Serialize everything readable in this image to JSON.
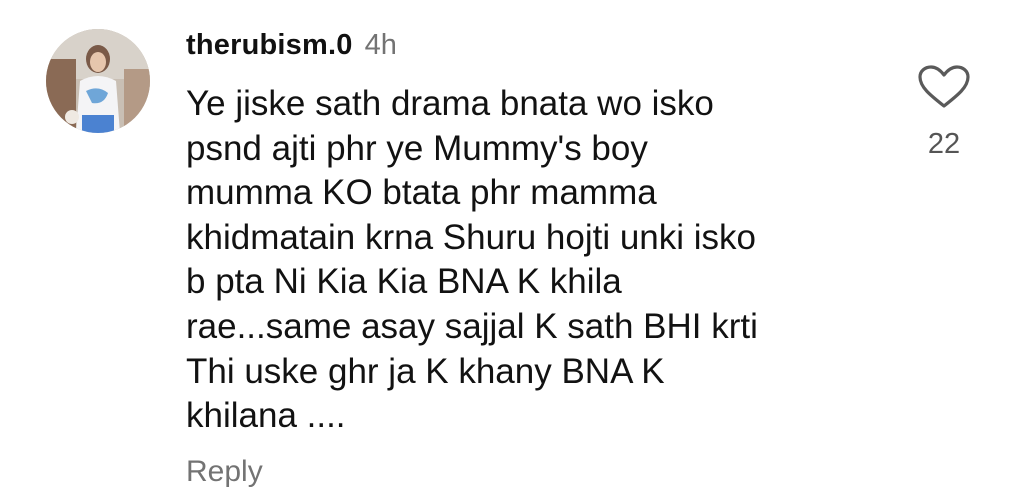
{
  "comment": {
    "username": "therubism.0",
    "timestamp": "4h",
    "text_lines": [
      "Ye jiske sath drama bnata wo isko",
      "psnd ajti phr ye Mummy's boy",
      "mumma KO btata phr mamma",
      "khidmatain krna Shuru hojti unki isko",
      "b pta Ni Kia Kia BNA K khila",
      "rae...same asay sajjal K sath BHI krti",
      "Thi uske ghr ja K khany BNA K",
      "khilana ...."
    ],
    "reply_label": "Reply",
    "like_count": "22",
    "like_icon": "heart-outline-icon",
    "avatar_icon": "profile-photo"
  }
}
